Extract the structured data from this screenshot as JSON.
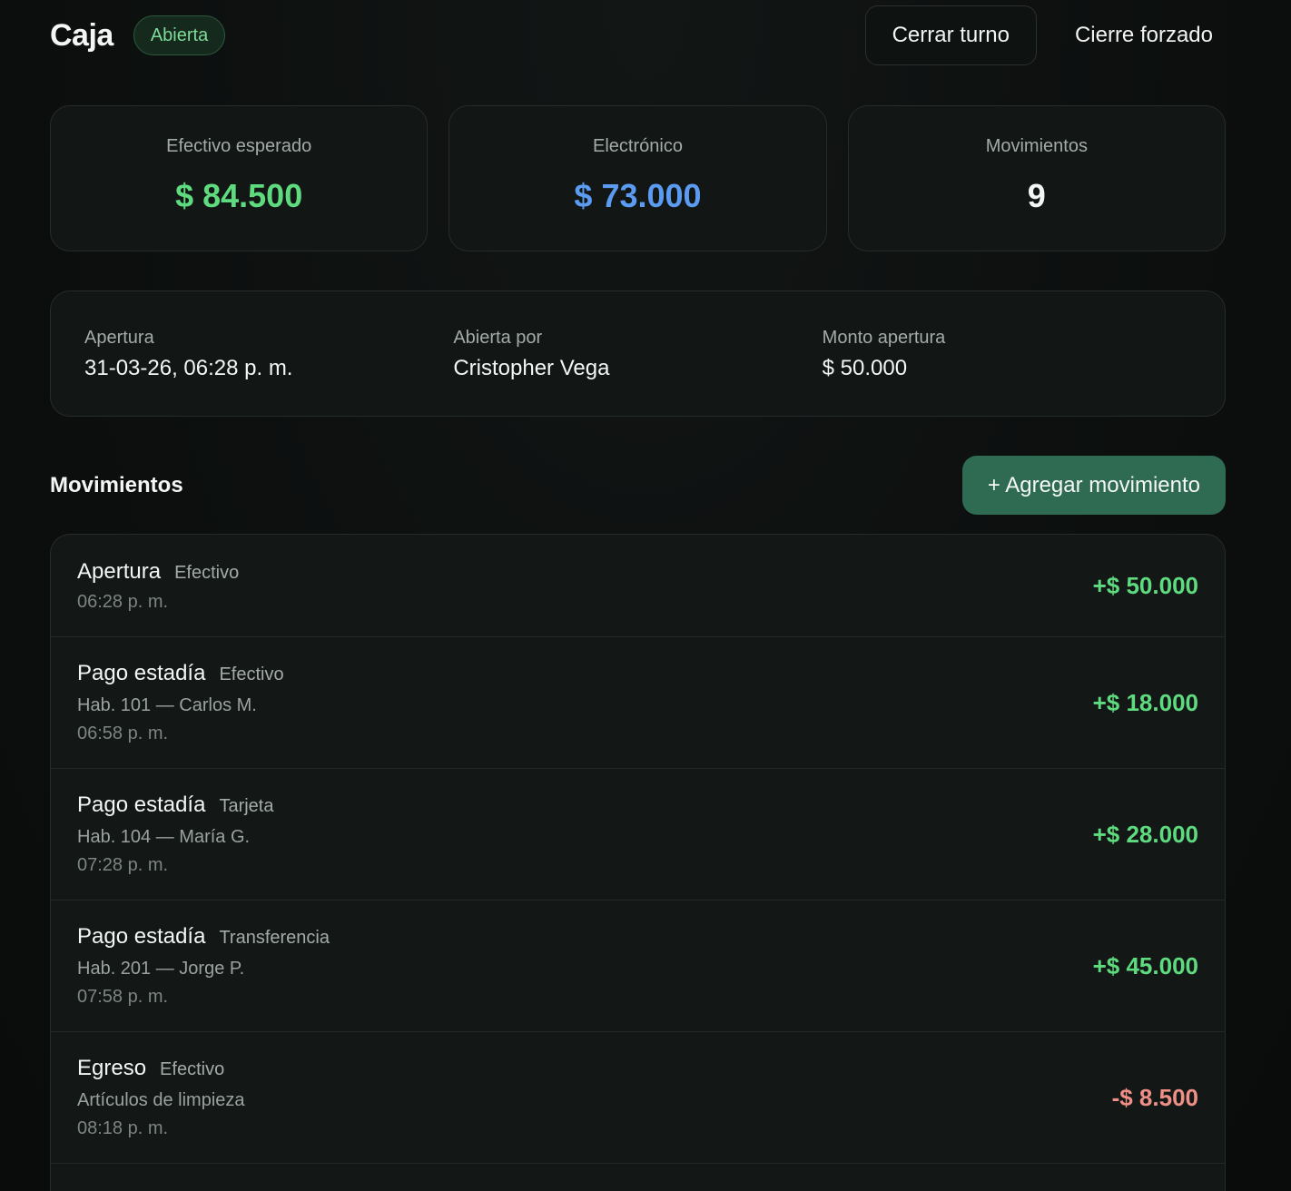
{
  "header": {
    "title": "Caja",
    "status_badge": "Abierta",
    "close_shift_label": "Cerrar turno",
    "force_close_label": "Cierre forzado"
  },
  "stats": [
    {
      "label": "Efectivo esperado",
      "value": "$ 84.500",
      "color": "#5fdb7f"
    },
    {
      "label": "Electrónico",
      "value": "$ 73.000",
      "color": "#5b9cf2"
    },
    {
      "label": "Movimientos",
      "value": "9",
      "color": "#f4f6f5"
    }
  ],
  "info": {
    "opening_label": "Apertura",
    "opening_value": "31-03-26, 06:28 p. m.",
    "opened_by_label": "Abierta por",
    "opened_by_value": "Cristopher Vega",
    "opening_amount_label": "Monto apertura",
    "opening_amount_value": "$ 50.000"
  },
  "movements": {
    "title": "Movimientos",
    "add_button_label": "+ Agregar movimiento",
    "items": [
      {
        "title": "Apertura",
        "method": "Efectivo",
        "detail": "",
        "time": "06:28 p. m.",
        "amount": "+$ 50.000",
        "type": "positive"
      },
      {
        "title": "Pago estadía",
        "method": "Efectivo",
        "detail": "Hab. 101 — Carlos M.",
        "time": "06:58 p. m.",
        "amount": "+$ 18.000",
        "type": "positive"
      },
      {
        "title": "Pago estadía",
        "method": "Tarjeta",
        "detail": "Hab. 104 — María G.",
        "time": "07:28 p. m.",
        "amount": "+$ 28.000",
        "type": "positive"
      },
      {
        "title": "Pago estadía",
        "method": "Transferencia",
        "detail": "Hab. 201 — Jorge P.",
        "time": "07:58 p. m.",
        "amount": "+$ 45.000",
        "type": "positive"
      },
      {
        "title": "Egreso",
        "method": "Efectivo",
        "detail": "Artículos de limpieza",
        "time": "08:18 p. m.",
        "amount": "-$ 8.500",
        "type": "negative"
      }
    ]
  }
}
